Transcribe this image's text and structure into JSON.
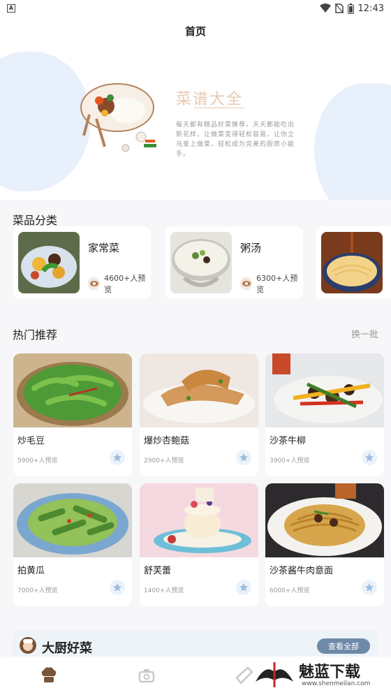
{
  "status_bar": {
    "time": "12:43",
    "left_icon": "a-letter-icon",
    "right_icons": [
      "wifi-icon",
      "no-sim-icon",
      "battery-icon"
    ]
  },
  "header": {
    "title": "首页"
  },
  "hero": {
    "title": "菜谱大全",
    "description": "每天都有精品好菜推荐，天天都能吃出新花样，让做菜变得轻松容易，让你立马爱上做菜，轻松成为完美的厨房小能手。"
  },
  "categories": {
    "title": "菜品分类",
    "items": [
      {
        "name": "家常菜",
        "views": "4600+人预览"
      },
      {
        "name": "粥汤",
        "views": "6300+人预览"
      },
      {
        "name": "",
        "views": ""
      }
    ]
  },
  "hot": {
    "title": "热门推荐",
    "refresh_label": "换一批",
    "items": [
      {
        "name": "炒毛豆",
        "views": "5900+人预览"
      },
      {
        "name": "爆炒杏鲍菇",
        "views": "2900+人预览"
      },
      {
        "name": "沙茶牛柳",
        "views": "3900+人预览"
      },
      {
        "name": "拍黄瓜",
        "views": "7000+人预览"
      },
      {
        "name": "舒芙蕾",
        "views": "1400+人预览"
      },
      {
        "name": "沙茶酱牛肉意面",
        "views": "6000+人预览"
      }
    ]
  },
  "chef": {
    "title": "大厨好菜",
    "view_all_label": "查看全部"
  },
  "tabbar": {
    "tabs": [
      "chef-hat-icon",
      "pot-icon",
      "compass-icon",
      "user-icon"
    ]
  },
  "watermark": {
    "brand": "魅蓝下载",
    "url": "www.shenmeilan.com"
  },
  "colors": {
    "accent": "#6f8aa8",
    "hero_title": "#e8c9b0",
    "blob": "#e8f0fb"
  }
}
